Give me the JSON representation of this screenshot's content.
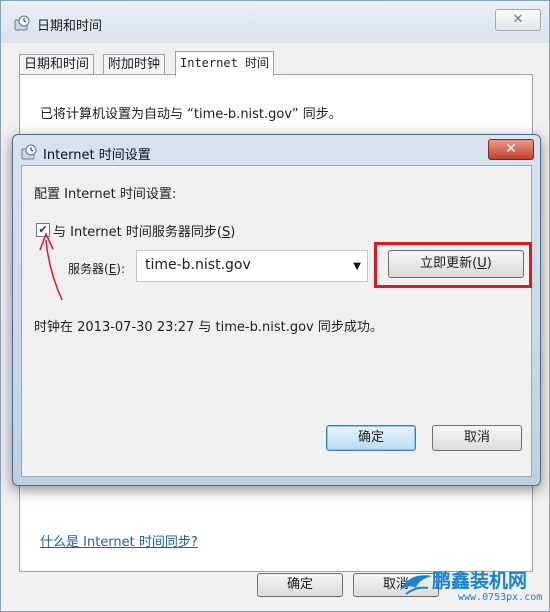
{
  "outer_window": {
    "title": "日期和时间",
    "close_glyph": "✕",
    "tabs": [
      {
        "label": "日期和时间"
      },
      {
        "label": "附加时钟"
      },
      {
        "label": "Internet 时间"
      }
    ],
    "status_text": "已将计算机设置为自动与 “time-b.nist.gov” 同步。",
    "help_link": "什么是 Internet 时间同步?",
    "ok_label": "确定",
    "cancel_label": "取消"
  },
  "dialog": {
    "title": "Internet 时间设置",
    "close_glyph": "✕",
    "config_label": "配置 Internet 时间设置:",
    "sync_checkbox": {
      "checked": true,
      "label": "与 Internet 时间服务器同步",
      "accel": "S"
    },
    "server": {
      "label": "服务器",
      "accel": "E",
      "value": "time-b.nist.gov"
    },
    "update_button": {
      "label": "立即更新",
      "accel": "U"
    },
    "status": "时钟在 2013-07-30 23:27 与 time-b.nist.gov 同步成功。",
    "ok_label": "确定",
    "cancel_label": "取消"
  },
  "watermark": {
    "brand": "鹏鑫装机网",
    "url": "www.0753px.com"
  },
  "colors": {
    "highlight": "#e01722",
    "link": "#1d5bbf",
    "dialog_close": "#c4402c"
  }
}
